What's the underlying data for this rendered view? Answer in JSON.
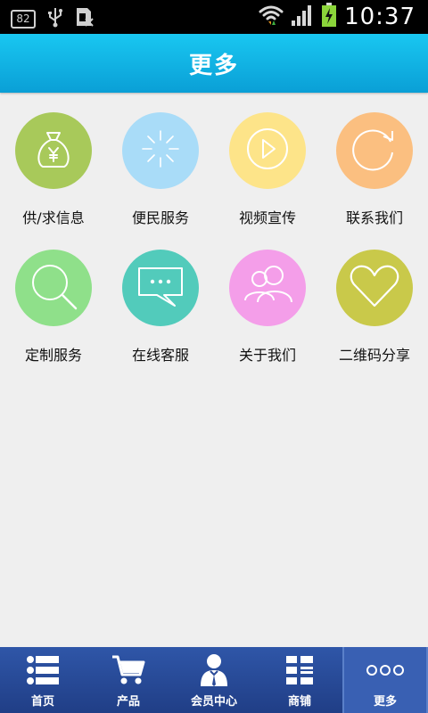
{
  "status_bar": {
    "battery_number": "82",
    "time": "10:37",
    "icons": [
      "battery-level-icon",
      "usb-icon",
      "sim-icon",
      "wifi-icon",
      "signal-icon",
      "battery-charging-icon"
    ]
  },
  "header": {
    "title": "更多"
  },
  "grid": {
    "items": [
      {
        "label": "供/求信息",
        "icon": "money-bag-icon",
        "color": "#a8c95a"
      },
      {
        "label": "便民服务",
        "icon": "loading-spinner-icon",
        "color": "#a9dcf8"
      },
      {
        "label": "视频宣传",
        "icon": "play-icon",
        "color": "#fde489"
      },
      {
        "label": "联系我们",
        "icon": "refresh-icon",
        "color": "#fbbf80"
      },
      {
        "label": "定制服务",
        "icon": "search-icon",
        "color": "#8fe08a"
      },
      {
        "label": "在线客服",
        "icon": "chat-icon",
        "color": "#52cbbb"
      },
      {
        "label": "关于我们",
        "icon": "users-icon",
        "color": "#f49ee9"
      },
      {
        "label": "二维码分享",
        "icon": "heart-icon",
        "color": "#c9c94a"
      }
    ]
  },
  "bottom_nav": {
    "items": [
      {
        "label": "首页",
        "icon": "list-icon"
      },
      {
        "label": "产品",
        "icon": "cart-icon"
      },
      {
        "label": "会员中心",
        "icon": "member-icon"
      },
      {
        "label": "商铺",
        "icon": "grid-list-icon"
      },
      {
        "label": "更多",
        "icon": "more-dots-icon",
        "active": true
      }
    ]
  }
}
